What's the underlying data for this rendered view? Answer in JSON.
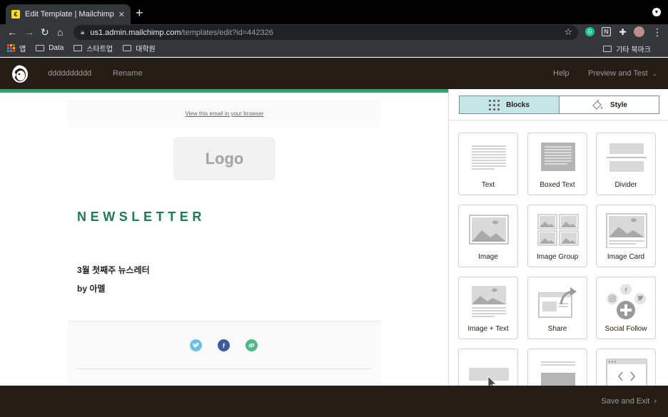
{
  "browser": {
    "tab_title": "Edit Template | Mailchimp",
    "tab_close": "✕",
    "new_tab": "+",
    "url_host": "us1.admin.mailchimp.com",
    "url_path": "/templates/edit?id=442326",
    "ext_g": "G",
    "ext_n": "N",
    "bookmarks": [
      "앱",
      "Data",
      "스타트업",
      "대학원"
    ],
    "bookmarks_right": "기타 북마크"
  },
  "header": {
    "template_name": "dddddddddd",
    "rename": "Rename",
    "help": "Help",
    "preview": "Preview and Test"
  },
  "email": {
    "preheader_link": "View this email in your browser",
    "logo": "Logo",
    "title": "NEWSLETTER",
    "line1": "3월 첫째주 뉴스레터",
    "line2": "by 아멜"
  },
  "panel": {
    "tab_blocks": "Blocks",
    "tab_style": "Style",
    "blocks": [
      "Text",
      "Boxed Text",
      "Divider",
      "Image",
      "Image Group",
      "Image Card",
      "Image + Text",
      "Share",
      "Social Follow"
    ]
  },
  "footer": {
    "save_exit": "Save and Exit"
  },
  "colors": {
    "brand_dark": "#241c15",
    "accent_green": "#37a16c",
    "title_green": "#1b7a58",
    "blocks_tab_bg": "#c4e6e7"
  }
}
